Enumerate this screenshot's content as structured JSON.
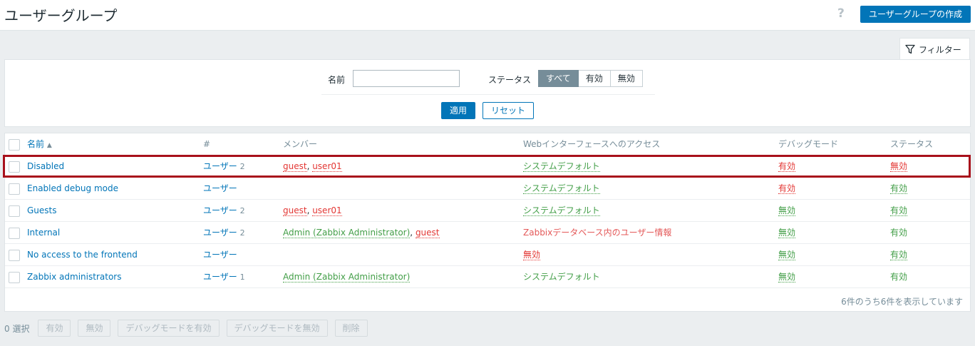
{
  "header": {
    "title": "ユーザーグループ",
    "help": "?",
    "create_button": "ユーザーグループの作成"
  },
  "filter": {
    "tab_label": "フィルター",
    "name_label": "名前",
    "name_value": "",
    "status_label": "ステータス",
    "status_options": [
      "すべて",
      "有効",
      "無効"
    ],
    "status_selected": "すべて",
    "apply": "適用",
    "reset": "リセット"
  },
  "table": {
    "columns": {
      "name": "名前",
      "sort_arrow": "▲",
      "count": "#",
      "members": "メンバー",
      "web_access": "Webインターフェースへのアクセス",
      "debug": "デバッグモード",
      "status": "ステータス"
    },
    "rows": [
      {
        "name": "Disabled",
        "users_label": "ユーザー",
        "users_count": "2",
        "members": [
          {
            "text": "guest",
            "color": "red"
          },
          {
            "text": "user01",
            "color": "red"
          }
        ],
        "web_access": "システムデフォルト",
        "debug": "有効",
        "status": "無効"
      },
      {
        "name": "Enabled debug mode",
        "users_label": "ユーザー",
        "users_count": "",
        "members": [],
        "web_access": "システムデフォルト",
        "debug": "有効",
        "status": "有効"
      },
      {
        "name": "Guests",
        "users_label": "ユーザー",
        "users_count": "2",
        "members": [
          {
            "text": "guest",
            "color": "red"
          },
          {
            "text": "user01",
            "color": "red"
          }
        ],
        "web_access": "システムデフォルト",
        "debug": "無効",
        "status": "有効"
      },
      {
        "name": "Internal",
        "users_label": "ユーザー",
        "users_count": "2",
        "members": [
          {
            "text": "Admin (Zabbix Administrator)",
            "color": "green"
          },
          {
            "text": "guest",
            "color": "red"
          }
        ],
        "web_access": "Zabbixデータベース内のユーザー情報",
        "debug": "無効",
        "status": "有効"
      },
      {
        "name": "No access to the frontend",
        "users_label": "ユーザー",
        "users_count": "",
        "members": [],
        "web_access": "無効",
        "debug": "無効",
        "status": "有効"
      },
      {
        "name": "Zabbix administrators",
        "users_label": "ユーザー",
        "users_count": "1",
        "members": [
          {
            "text": "Admin (Zabbix Administrator)",
            "color": "green"
          }
        ],
        "web_access": "システムデフォルト",
        "debug": "無効",
        "status": "有効"
      }
    ],
    "footer": "6件のうち6件を表示しています"
  },
  "mass_actions": {
    "selected": "0 選択",
    "buttons": [
      "有効",
      "無効",
      "デバッグモードを有効",
      "デバッグモードを無効",
      "削除"
    ]
  },
  "colors": {
    "accent": "#0275b8",
    "red": "#e33734",
    "green": "#429e47",
    "highlight": "#a8101b"
  }
}
